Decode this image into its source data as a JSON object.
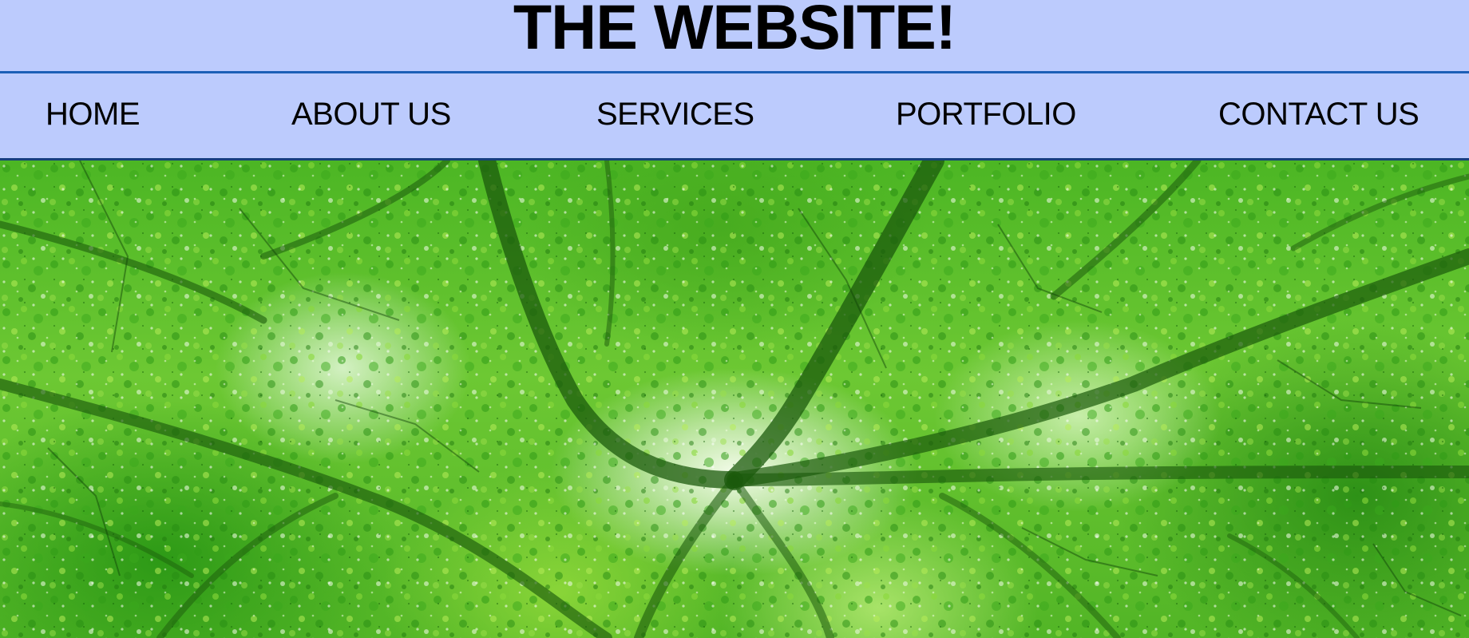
{
  "header": {
    "title": "THE WEBSITE!"
  },
  "nav": {
    "items": [
      {
        "label": "HOME"
      },
      {
        "label": "ABOUT US"
      },
      {
        "label": "SERVICES"
      },
      {
        "label": "PORTFOLIO"
      },
      {
        "label": "CONTACT US"
      }
    ]
  },
  "colors": {
    "header_background": "#bccbfd",
    "header_border": "#1c5fb7",
    "title_text": "#000000",
    "nav_text": "#000000"
  },
  "hero": {
    "image_subject": "green forest canopy viewed from below"
  }
}
